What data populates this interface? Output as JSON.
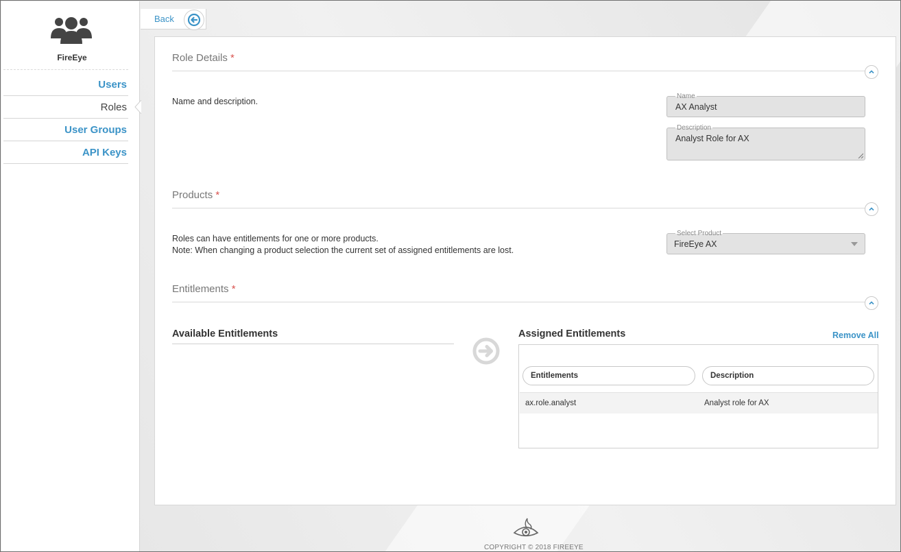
{
  "brand": {
    "name": "FireEye",
    "icon": "users-group-icon"
  },
  "sidebar": {
    "items": [
      {
        "label": "Users",
        "active": false
      },
      {
        "label": "Roles",
        "active": true
      },
      {
        "label": "User Groups",
        "active": false
      },
      {
        "label": "API Keys",
        "active": false
      }
    ]
  },
  "topbar": {
    "back_label": "Back",
    "back_icon": "arrow-left-circle-icon"
  },
  "role_details": {
    "title": "Role Details",
    "required_mark": "*",
    "description": "Name and description.",
    "name_label": "Name",
    "name_value": "AX Analyst",
    "description_label": "Description",
    "description_value": "Analyst Role for AX"
  },
  "products": {
    "title": "Products",
    "required_mark": "*",
    "line1": "Roles can have entitlements for one or more products.",
    "line2": "Note: When changing a product selection the current set of assigned entitlements are lost.",
    "select_label": "Select Product",
    "select_value": "FireEye AX"
  },
  "entitlements": {
    "title": "Entitlements",
    "required_mark": "*",
    "available_title": "Available Entitlements",
    "assigned_title": "Assigned Entitlements",
    "remove_all": "Remove All",
    "columns": [
      "Entitlements",
      "Description"
    ],
    "rows": [
      {
        "entitlement": "ax.role.analyst",
        "description": "Analyst role for AX"
      }
    ]
  },
  "footer": {
    "copyright": "COPYRIGHT © 2018 FIREEYE",
    "logo": "fireeye-eye-logo-icon"
  },
  "colors": {
    "accent": "#3b93c7",
    "required": "#d9534f",
    "field_bg": "#e3e3e3"
  }
}
